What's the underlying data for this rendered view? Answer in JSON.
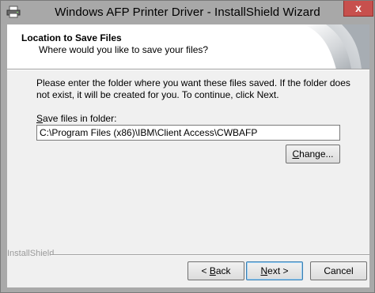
{
  "window": {
    "title": "Windows AFP Printer Driver - InstallShield Wizard",
    "close_glyph": "x",
    "icon": "printer-icon"
  },
  "header": {
    "title": "Location to Save Files",
    "subtitle": "Where would you like to save your files?"
  },
  "body": {
    "description": "Please enter the folder where you want these files saved.  If the folder does not exist, it will be created for you.   To continue, click Next.",
    "field_label_prefix": "S",
    "field_label_rest": "ave files in folder:",
    "folder_path": "C:\\Program Files (x86)\\IBM\\Client Access\\CWBAFP",
    "change_label_prefix": "C",
    "change_label_rest": "hange..."
  },
  "footer": {
    "brand": "InstallShield",
    "back_prefix": "< ",
    "back_underline": "B",
    "back_rest": "ack",
    "next_underline": "N",
    "next_rest": "ext >",
    "cancel_label": "Cancel"
  },
  "colors": {
    "close_button": "#c7504d",
    "title_bar": "#a8a8a8",
    "default_button_border": "#3c7fb1"
  }
}
